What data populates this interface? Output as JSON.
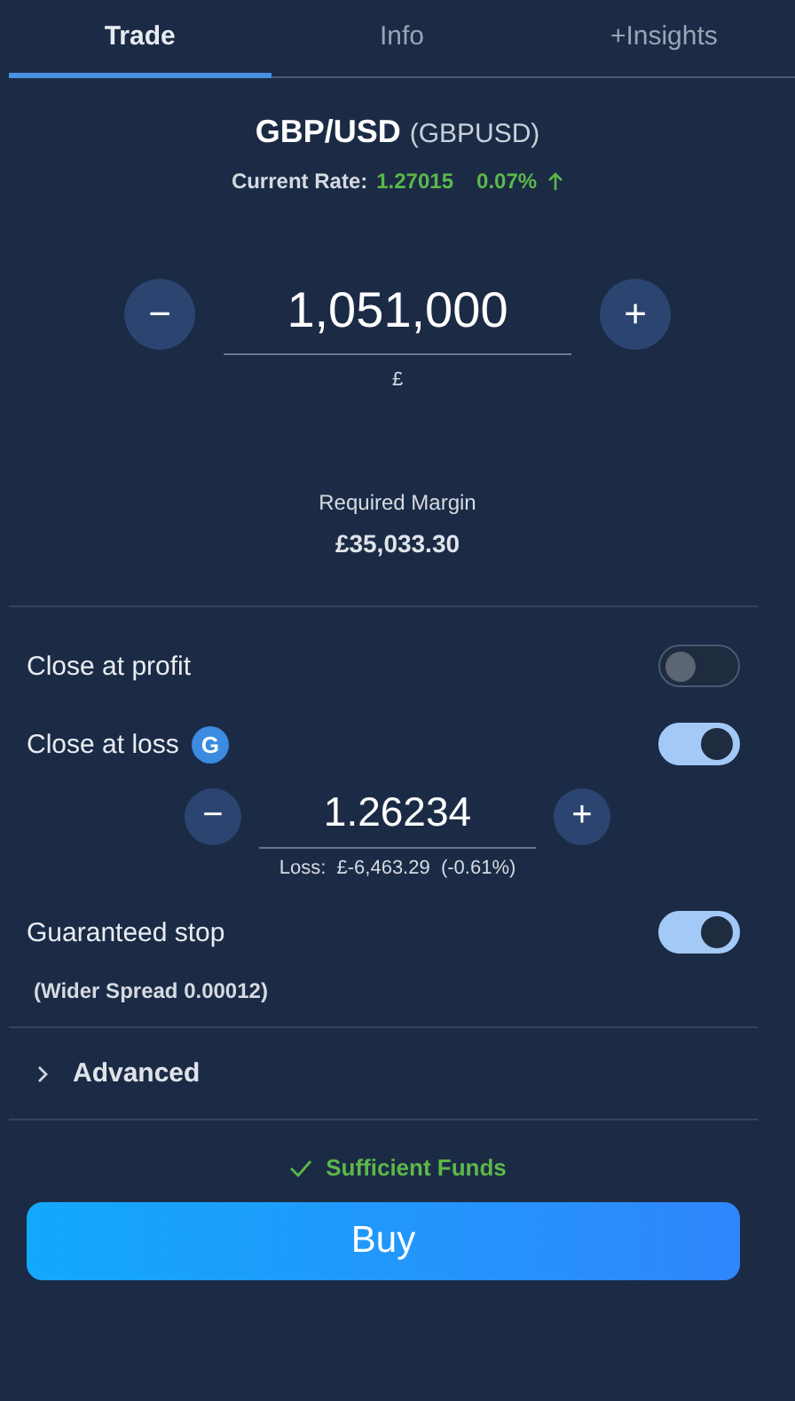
{
  "tabs": [
    {
      "label": "Trade",
      "selected": true
    },
    {
      "label": "Info",
      "selected": false
    },
    {
      "label": "+Insights",
      "selected": false
    }
  ],
  "instrument": {
    "name": "GBP/USD",
    "symbol": "(GBPUSD)"
  },
  "rate": {
    "label": "Current Rate:",
    "value": "1.27015",
    "change": "0.07%",
    "rising": true
  },
  "amount": {
    "minus": "−",
    "value": "1,051,000",
    "plus": "+",
    "unit": "£"
  },
  "margin": {
    "label": "Required Margin",
    "value": "£35,033.30"
  },
  "close_at_profit": {
    "label": "Close at profit",
    "on": false
  },
  "close_at_loss": {
    "label": "Close at loss",
    "badge": "G",
    "on": true,
    "minus": "−",
    "value": "1.26234",
    "plus": "+",
    "loss": "Loss:  £-6,463.29  (-0.61%)"
  },
  "guaranteed_stop": {
    "label": "Guaranteed stop",
    "on": true,
    "note": "(Wider Spread 0.00012)"
  },
  "advanced": {
    "label": "Advanced",
    "expanded": false
  },
  "funds": {
    "text": "Sufficient Funds",
    "ok": true
  },
  "buy_button": {
    "label": "Buy"
  }
}
